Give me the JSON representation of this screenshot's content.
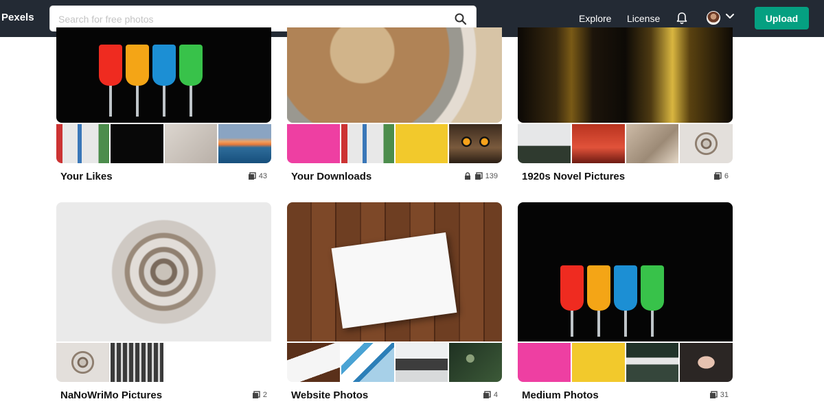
{
  "app": {
    "logo": "Pexels"
  },
  "search": {
    "placeholder": "Search for free photos",
    "value": ""
  },
  "nav": {
    "explore": "Explore",
    "license": "License",
    "upload": "Upload"
  },
  "icons": {
    "search": "search-icon",
    "notifications": "bell-icon",
    "account_menu": "chevron-down-icon",
    "photo_count": "image-stack-icon",
    "private": "lock-icon"
  },
  "colors": {
    "topbar": "#232a34",
    "accent": "#05a081",
    "title": "#111111"
  },
  "collections": [
    {
      "title": "Your Likes",
      "count": "43",
      "locked": false
    },
    {
      "title": "Your Downloads",
      "count": "139",
      "locked": true
    },
    {
      "title": "1920s Novel Pictures",
      "count": "6",
      "locked": false
    },
    {
      "title": "NaNoWriMo Pictures",
      "count": "2",
      "locked": false
    },
    {
      "title": "Website Photos",
      "count": "4",
      "locked": false
    },
    {
      "title": "Medium Photos",
      "count": "31",
      "locked": false
    }
  ]
}
